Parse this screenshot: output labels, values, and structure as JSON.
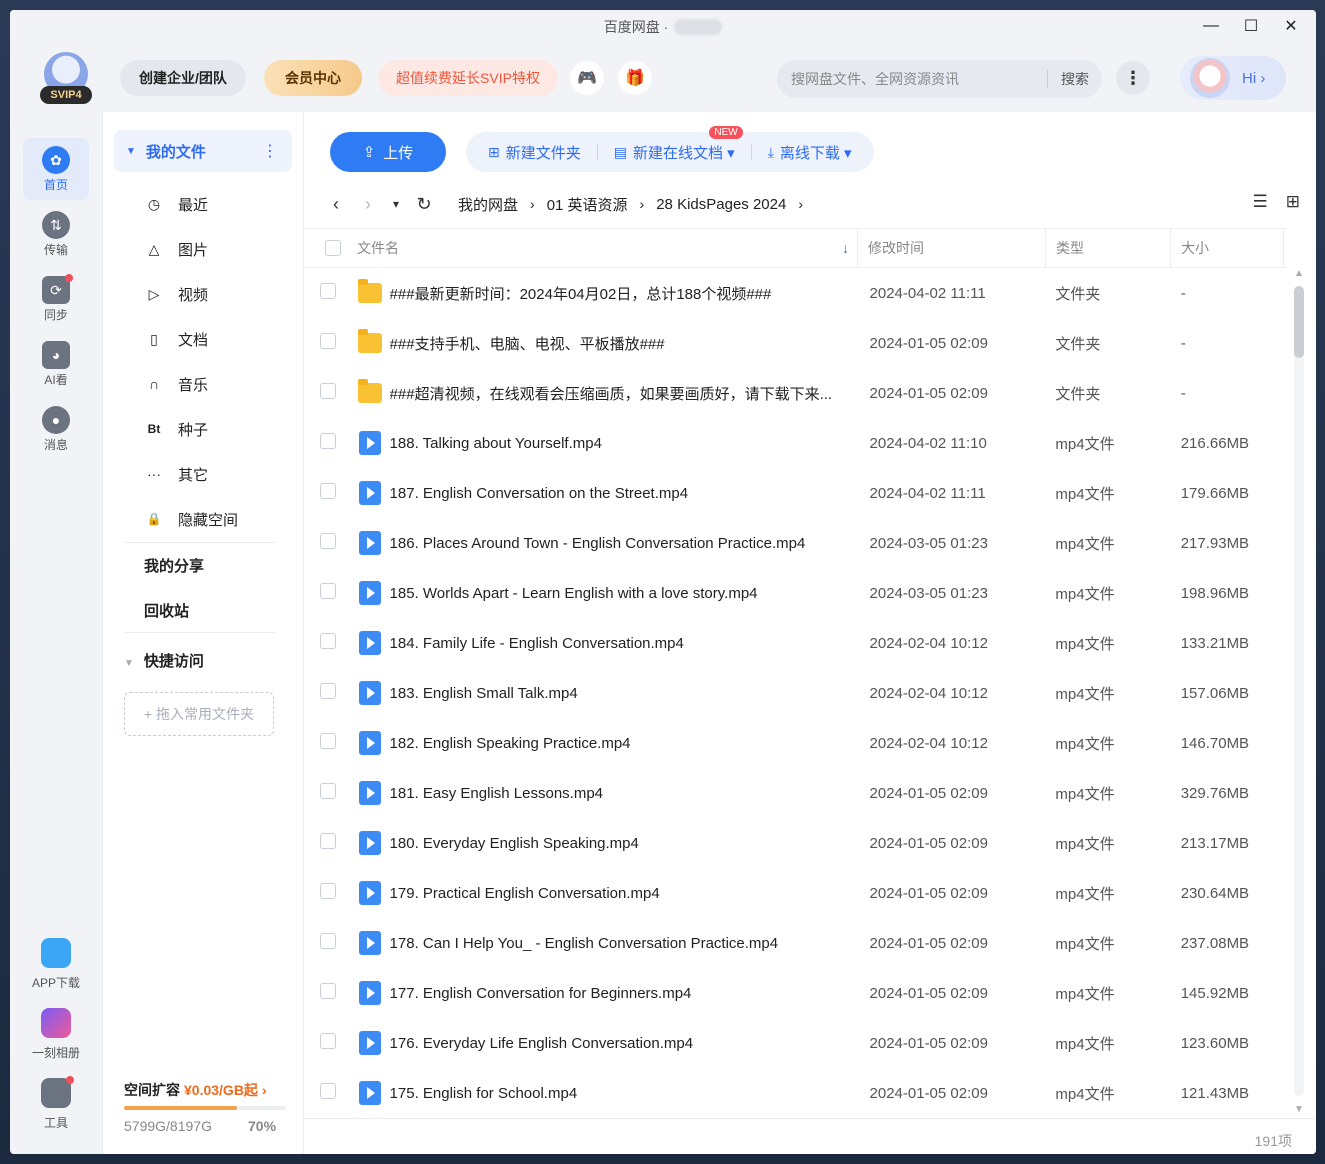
{
  "window": {
    "title": "百度网盘",
    "controls": {
      "minimize": "—",
      "maximize": "☐",
      "close": "✕"
    }
  },
  "topbar": {
    "svip_badge": "SVIP4",
    "team_label": "创建企业/团队",
    "vip_label": "会员中心",
    "promo_label": "超值续费延长SVIP特权",
    "game_icon": "🎮",
    "gift_icon": "🎁",
    "search_placeholder": "搜网盘文件、全网资源资讯",
    "search_button": "搜索",
    "more_icon": "⋮",
    "hi_label": "Hi ›"
  },
  "rail": {
    "items": [
      {
        "label": "首页",
        "icon": "home-icon",
        "active": true
      },
      {
        "label": "传输",
        "icon": "transfer-icon"
      },
      {
        "label": "同步",
        "icon": "sync-icon",
        "dot": true
      },
      {
        "label": "AI看",
        "icon": "ai-icon"
      },
      {
        "label": "消息",
        "icon": "message-icon"
      }
    ],
    "bottom": [
      {
        "label": "APP下载",
        "icon": "phone-icon"
      },
      {
        "label": "一刻相册",
        "icon": "album-icon"
      },
      {
        "label": "工具",
        "icon": "tools-icon",
        "dot": true
      }
    ]
  },
  "nav": {
    "head": "我的文件",
    "items": [
      {
        "label": "最近",
        "icon": "◷"
      },
      {
        "label": "图片",
        "icon": "△"
      },
      {
        "label": "视频",
        "icon": "▷"
      },
      {
        "label": "文档",
        "icon": "▯"
      },
      {
        "label": "音乐",
        "icon": "∩"
      },
      {
        "label": "种子",
        "icon": "Bt"
      },
      {
        "label": "其它",
        "icon": "···"
      },
      {
        "label": "隐藏空间",
        "icon": "🔒"
      }
    ],
    "share": "我的分享",
    "recycle": "回收站",
    "quick": "快捷访问",
    "drop_hint": "+ 拖入常用文件夹",
    "quota_title": "空间扩容",
    "quota_price": "¥0.03/GB起 ›",
    "quota_used": "5799G/8197G",
    "quota_pct": "70%",
    "quota_fraction": 0.7
  },
  "toolbar": {
    "upload": "上传",
    "new_folder": "新建文件夹",
    "new_doc": "新建在线文档 ▾",
    "new_badge": "NEW",
    "offline": "离线下载 ▾"
  },
  "path": {
    "back": "‹",
    "forward": "›",
    "dropdown": "▾",
    "refresh": "↻",
    "crumbs": [
      "我的网盘",
      "01 英语资源",
      "28 KidsPages 2024"
    ]
  },
  "table": {
    "headers": {
      "name": "文件名",
      "time": "修改时间",
      "type": "类型",
      "size": "大小"
    },
    "rows": [
      {
        "kind": "folder",
        "name": "###最新更新时间：2024年04月02日，总计188个视频###",
        "time": "2024-04-02 11:11",
        "type": "文件夹",
        "size": "-"
      },
      {
        "kind": "folder",
        "name": "###支持手机、电脑、电视、平板播放###",
        "time": "2024-01-05 02:09",
        "type": "文件夹",
        "size": "-"
      },
      {
        "kind": "folder",
        "name": "###超清视频，在线观看会压缩画质，如果要画质好，请下载下来...",
        "time": "2024-01-05 02:09",
        "type": "文件夹",
        "size": "-"
      },
      {
        "kind": "video",
        "name": "188. Talking about Yourself.mp4",
        "time": "2024-04-02 11:10",
        "type": "mp4文件",
        "size": "216.66MB"
      },
      {
        "kind": "video",
        "name": "187. English Conversation on the Street.mp4",
        "time": "2024-04-02 11:11",
        "type": "mp4文件",
        "size": "179.66MB"
      },
      {
        "kind": "video",
        "name": "186. Places Around Town - English Conversation Practice.mp4",
        "time": "2024-03-05 01:23",
        "type": "mp4文件",
        "size": "217.93MB"
      },
      {
        "kind": "video",
        "name": "185. Worlds Apart - Learn English with a love story.mp4",
        "time": "2024-03-05 01:23",
        "type": "mp4文件",
        "size": "198.96MB"
      },
      {
        "kind": "video",
        "name": "184. Family Life - English Conversation.mp4",
        "time": "2024-02-04 10:12",
        "type": "mp4文件",
        "size": "133.21MB"
      },
      {
        "kind": "video",
        "name": "183. English Small Talk.mp4",
        "time": "2024-02-04 10:12",
        "type": "mp4文件",
        "size": "157.06MB"
      },
      {
        "kind": "video",
        "name": "182. English Speaking Practice.mp4",
        "time": "2024-02-04 10:12",
        "type": "mp4文件",
        "size": "146.70MB"
      },
      {
        "kind": "video",
        "name": "181. Easy English Lessons.mp4",
        "time": "2024-01-05 02:09",
        "type": "mp4文件",
        "size": "329.76MB"
      },
      {
        "kind": "video",
        "name": "180. Everyday English Speaking.mp4",
        "time": "2024-01-05 02:09",
        "type": "mp4文件",
        "size": "213.17MB"
      },
      {
        "kind": "video",
        "name": "179. Practical English Conversation.mp4",
        "time": "2024-01-05 02:09",
        "type": "mp4文件",
        "size": "230.64MB"
      },
      {
        "kind": "video",
        "name": "178. Can I Help You_ - English Conversation Practice.mp4",
        "time": "2024-01-05 02:09",
        "type": "mp4文件",
        "size": "237.08MB"
      },
      {
        "kind": "video",
        "name": "177. English Conversation for Beginners.mp4",
        "time": "2024-01-05 02:09",
        "type": "mp4文件",
        "size": "145.92MB"
      },
      {
        "kind": "video",
        "name": "176. Everyday Life English Conversation.mp4",
        "time": "2024-01-05 02:09",
        "type": "mp4文件",
        "size": "123.60MB"
      },
      {
        "kind": "video",
        "name": "175. English for School.mp4",
        "time": "2024-01-05 02:09",
        "type": "mp4文件",
        "size": "121.43MB"
      }
    ],
    "count": "191项"
  },
  "colors": {
    "accent": "#2f6bf2",
    "upload": "#2f7bf4",
    "folder": "#f8c232",
    "video": "#3d8cf5",
    "promo": "#f0553a",
    "quota": "#f6a24a"
  }
}
